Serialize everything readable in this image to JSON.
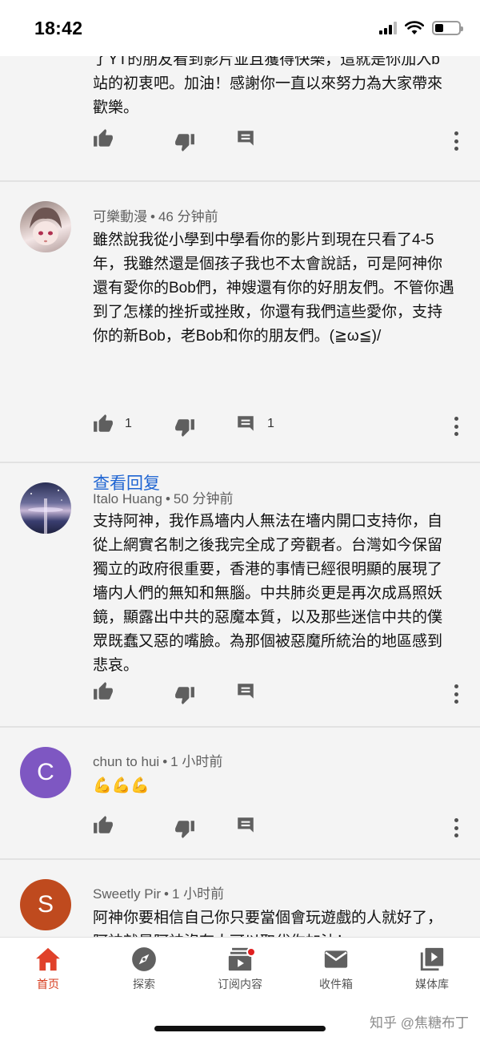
{
  "status_bar": {
    "time": "18:42"
  },
  "comments": [
    {
      "text": "了YT的朋友看到影片並且獲得快樂，這就是你加入b站的初衷吧。加油！感謝你一直以來努力為大家帶來歡樂。",
      "likes": "",
      "replies": ""
    },
    {
      "author": "可樂動漫",
      "time": "46 分钟前",
      "text": "雖然說我從小學到中學看你的影片到現在只看了4-5年，我雖然還是個孩子我也不太會說話，可是阿神你還有愛你的Bob們，神嫂還有你的好朋友們。不管你遇到了怎樣的挫折或挫敗，你還有我們這些愛你，支持你的新Bob，老Bob和你的朋友們。(≧ω≦)/",
      "likes": "1",
      "replies": "1",
      "view_replies": "查看回复"
    },
    {
      "author": "Italo Huang",
      "time": "50 分钟前",
      "text": "支持阿神，我作爲墻内人無法在墻内開口支持你，自從上網實名制之後我完全成了旁觀者。台灣如今保留獨立的政府很重要，香港的事情已經很明顯的展現了墻内人們的無知和無腦。中共肺炎更是再次成爲照妖鏡，顯露出中共的惡魔本質，以及那些迷信中共的僕眾既蠢又惡的嘴臉。為那個被惡魔所統治的地區感到悲哀。",
      "likes": "",
      "replies": ""
    },
    {
      "author": "chun to hui",
      "time": "1 小时前",
      "avatar_letter": "C",
      "avatar_color": "#7e57c2",
      "text": "💪💪💪",
      "likes": "",
      "replies": ""
    },
    {
      "author": "Sweetly Pir",
      "time": "1 小时前",
      "avatar_letter": "S",
      "avatar_color": "#bf4a1e",
      "text": "阿神你要相信自己你只要當個會玩遊戲的人就好了，阿神就是阿神沒有人可以取代你加油！"
    }
  ],
  "tabs": [
    {
      "label": "首页",
      "icon": "home-icon",
      "active": true
    },
    {
      "label": "探索",
      "icon": "explore-icon"
    },
    {
      "label": "订阅内容",
      "icon": "subscriptions-icon"
    },
    {
      "label": "收件箱",
      "icon": "inbox-icon"
    },
    {
      "label": "媒体库",
      "icon": "library-icon"
    }
  ],
  "watermark": "知乎 @焦糖布丁",
  "colors": {
    "accent_active": "#d63a1c",
    "link": "#1e64d2",
    "notification": "#e02020"
  }
}
